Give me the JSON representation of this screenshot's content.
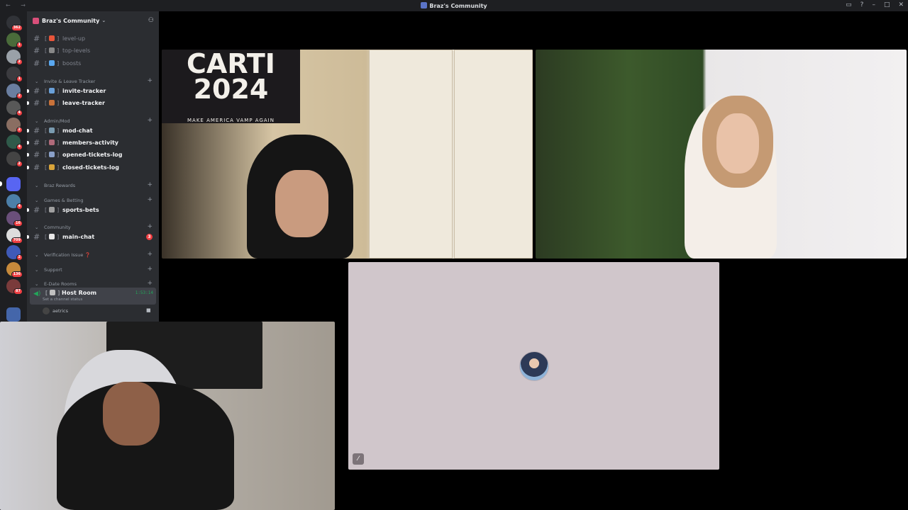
{
  "window": {
    "title": "Braz's Community",
    "nav": "← →"
  },
  "server": {
    "name": "Braz's Community"
  },
  "rail": {
    "top_badge": "362",
    "badges": [
      "1",
      "2",
      "1",
      "2",
      "4",
      "2",
      "4",
      "2",
      "4",
      "16",
      "709",
      "2",
      "136",
      "87"
    ]
  },
  "channels": {
    "level_up": "level-up",
    "top_levels": "top-levels",
    "boosts": "boosts",
    "invite_tracker": "invite-tracker",
    "leave_tracker": "leave-tracker",
    "mod_chat": "mod-chat",
    "members_activity": "members-activity",
    "opened_tickets_log": "opened-tickets-log",
    "closed_tickets_log": "closed-tickets-log",
    "sports_bets": "sports-bets",
    "main_chat": "main-chat",
    "main_chat_mentions": "3"
  },
  "categories": {
    "invite_leave": "Invite & Leave Tracker",
    "admin_mod": "Admin/Mod",
    "braz_rewards": "Braz Rewards",
    "games_betting": "Games & Betting",
    "community": "Community",
    "verification": "Verification Issue ❓",
    "support": "Support",
    "edate": "E-Date Rooms"
  },
  "voice": {
    "channel": "Host Room",
    "status_hint": "Set a channel status",
    "timer": "1:53:14",
    "member": "aetrics"
  },
  "tiles": {
    "banner_line1": "CARTI",
    "banner_line2": "2024",
    "banner_line3": "MAKE AMERICA VAMP AGAIN"
  }
}
